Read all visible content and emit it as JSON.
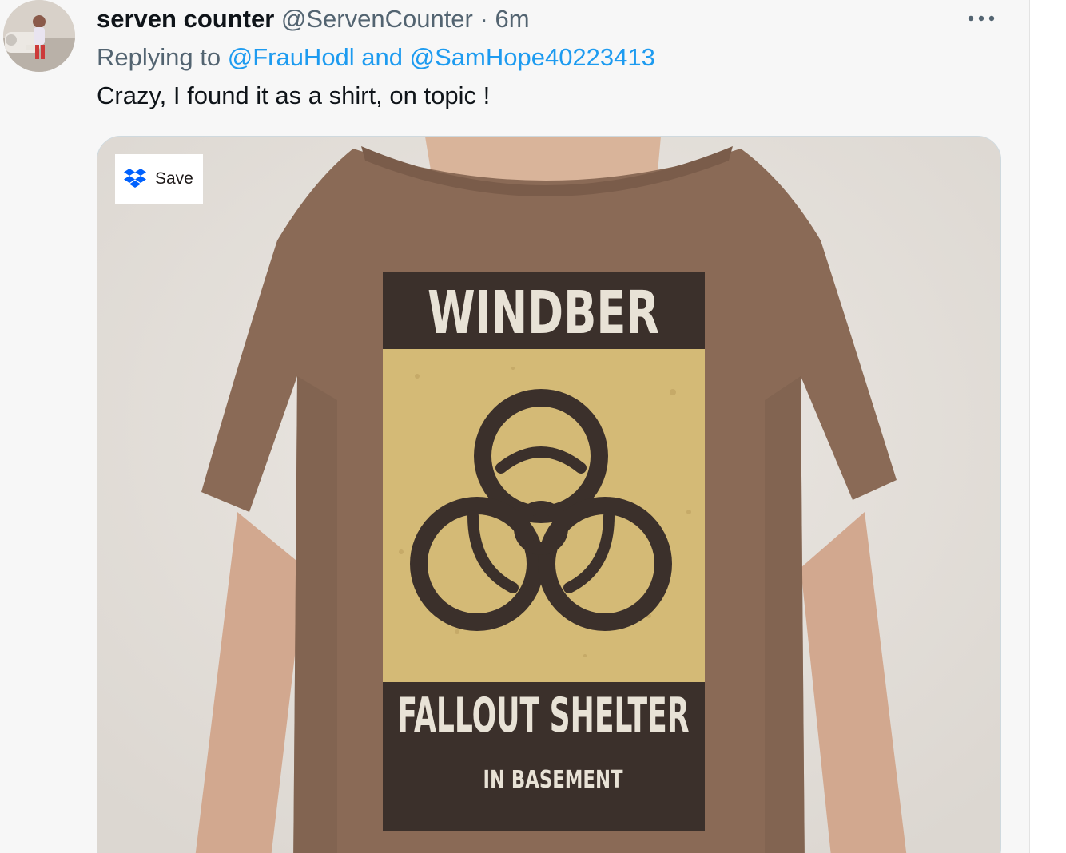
{
  "tweet": {
    "display_name": "serven counter",
    "handle": "@ServenCounter",
    "separator": "·",
    "time": "6m",
    "more_icon": "ellipsis-icon",
    "replying_prefix": "Replying to",
    "replying_to": "@FrauHodl and @SamHope40223413",
    "text": "Crazy, I found it as a shirt, on topic !"
  },
  "media": {
    "save_label": "Save",
    "save_icon": "dropbox-icon",
    "shirt": {
      "top_text": "WINDBER",
      "main_text": "FALLOUT SHELTER",
      "sub_text": "IN BASEMENT",
      "symbol": "biohazard-icon",
      "shirt_color": "#8a6a56",
      "panel_color": "#d4ba76",
      "band_color": "#3b302b"
    }
  },
  "colors": {
    "link": "#1d9bf0",
    "secondary_text": "#536471",
    "primary_text": "#0f1419",
    "dropbox_blue": "#0061fe"
  }
}
